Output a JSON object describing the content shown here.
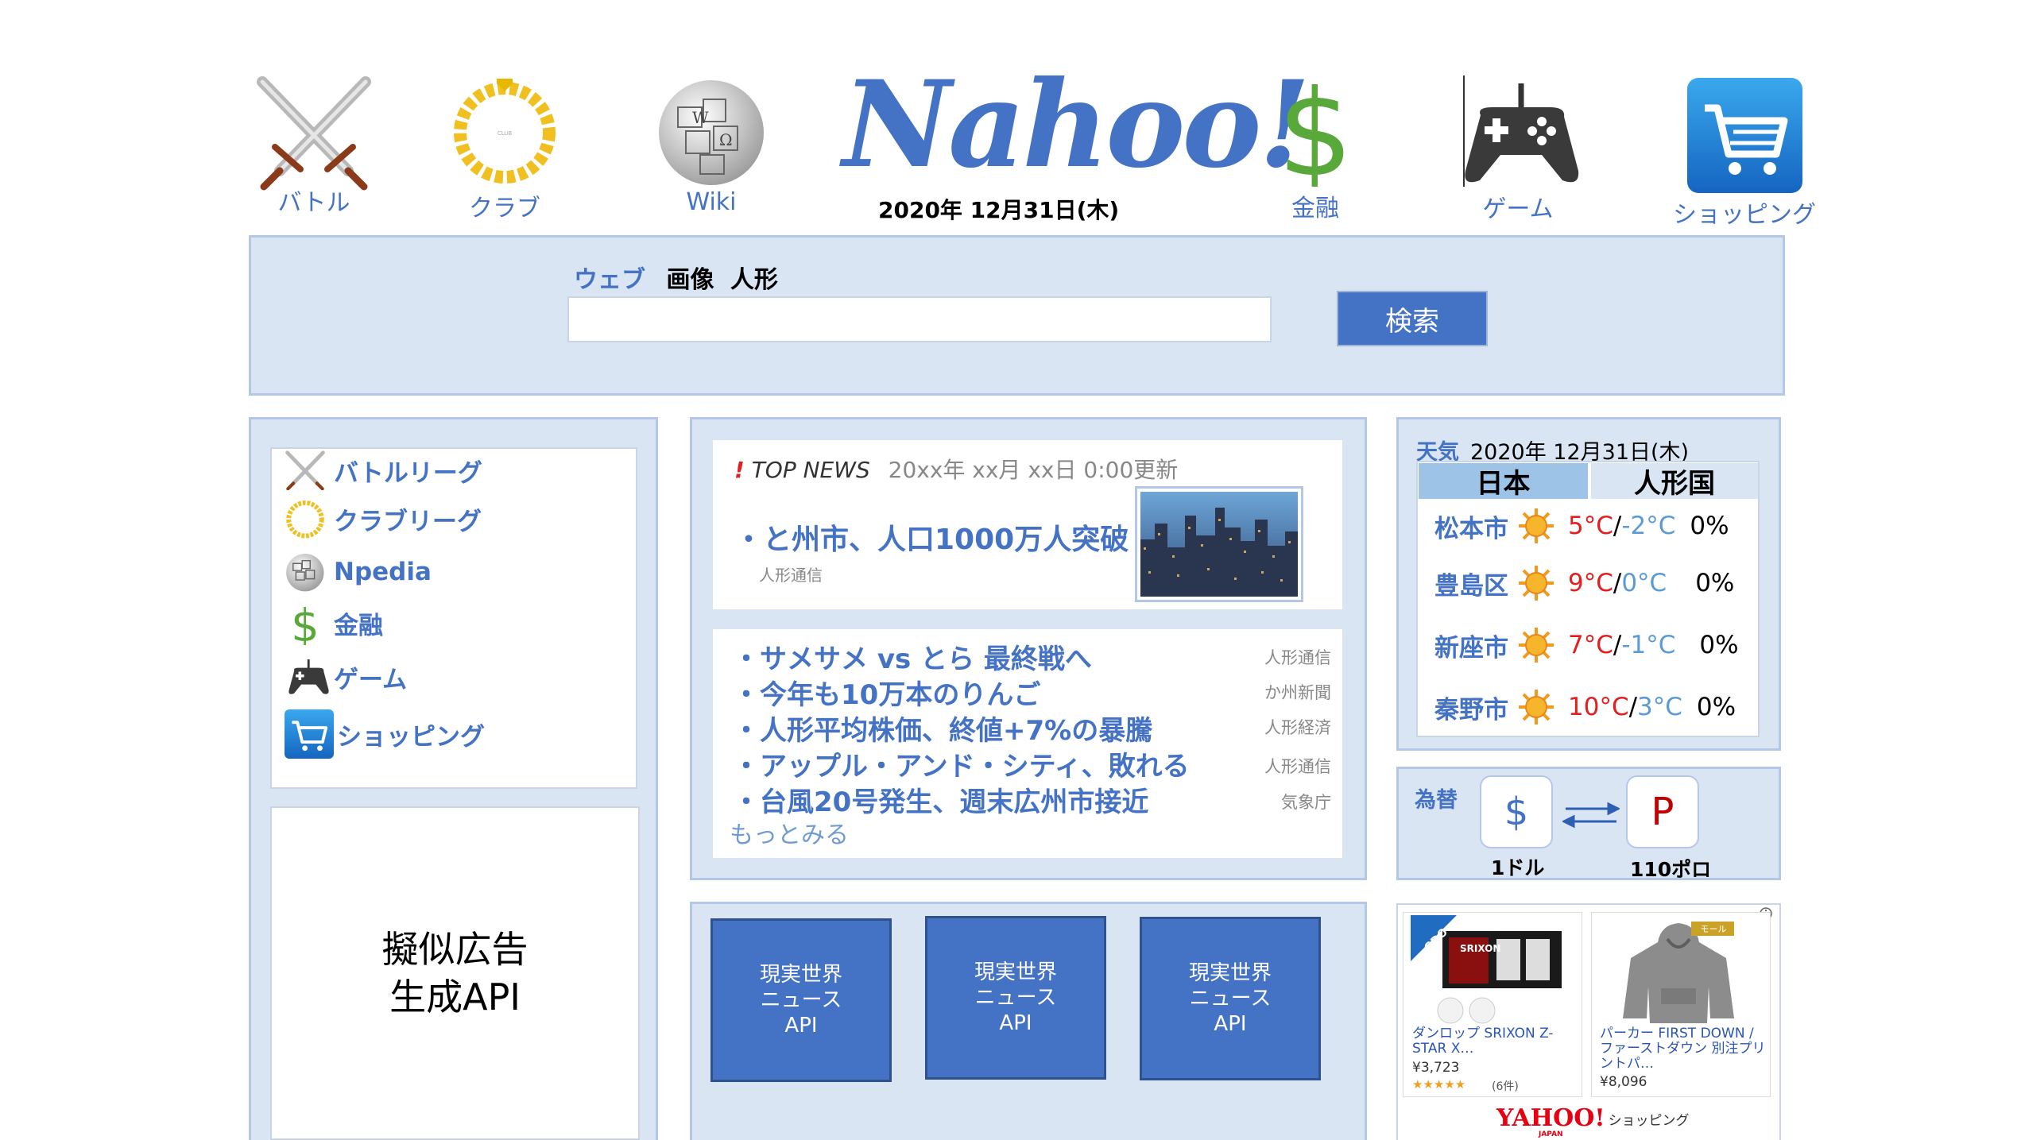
{
  "nav": {
    "battle": "バトル",
    "club": "クラブ",
    "wiki": "Wiki",
    "finance": "金融",
    "game": "ゲーム",
    "shopping": "ショッピング"
  },
  "logo": "Nahoo!",
  "date_top": "2020年 12月31日(木)",
  "search": {
    "tabs": {
      "web": "ウェブ",
      "image": "画像",
      "doll": "人形"
    },
    "button": "検索",
    "value": ""
  },
  "left_menu": {
    "items": [
      "バトルリーグ",
      "クラブリーグ",
      "Npedia",
      "金融",
      "ゲーム",
      "ショッピング"
    ]
  },
  "ad": {
    "line1": "擬似広告",
    "line2": "生成API"
  },
  "top_news": {
    "mark": "!",
    "label": "TOP NEWS",
    "updated": "20xx年 xx月 xx日 0:00更新",
    "headline": "・と州市、人口1000万人突破",
    "headline_source": "人形通信"
  },
  "news": {
    "items": [
      {
        "title": "・サメサメ vs とら 最終戦へ",
        "source": "人形通信"
      },
      {
        "title": "・今年も10万本のりんご",
        "source": "か州新聞"
      },
      {
        "title": "・人形平均株価、終値+7%の暴騰",
        "source": "人形経済"
      },
      {
        "title": "・アップル・アンド・シティ、敗れる",
        "source": "人形通信"
      },
      {
        "title": "・台風20号発生、週末広州市接近",
        "source": "気象庁"
      }
    ],
    "more": "もっとみる"
  },
  "api_boxes": [
    {
      "l1": "現実世界",
      "l2": "ニュース",
      "l3": "API"
    },
    {
      "l1": "現実世界",
      "l2": "ニュース",
      "l3": "API"
    },
    {
      "l1": "現実世界",
      "l2": "ニュース",
      "l3": "API"
    }
  ],
  "weather": {
    "label": "天気",
    "date": "2020年 12月31日(木)",
    "tabs": [
      "日本",
      "人形国"
    ],
    "rows": [
      {
        "city": "松本市",
        "hi": "5°C",
        "lo": "-2°C",
        "pct": "0%"
      },
      {
        "city": "豊島区",
        "hi": "9°C",
        "lo": "0°C",
        "pct": "0%"
      },
      {
        "city": "新座市",
        "hi": "7°C",
        "lo": "-1°C",
        "pct": "0%"
      },
      {
        "city": "秦野市",
        "hi": "10°C",
        "lo": "3°C",
        "pct": "0%"
      }
    ],
    "slash": "/"
  },
  "fx": {
    "label": "為替",
    "left_symbol": "$",
    "right_symbol": "P",
    "left_label": "1ドル",
    "right_label": "110ポロ"
  },
  "shop_ad": {
    "item1": {
      "badge": "GDO",
      "brand": "SRIXON",
      "title": "ダンロップ SRIXON Z-STAR X…",
      "price": "¥3,723",
      "stars": "★★★★★",
      "reviews": "(6件)"
    },
    "item2": {
      "badge": "モール",
      "title": "パーカー FIRST DOWN /ファーストダウン 別注プリントパ…",
      "price": "¥8,096"
    },
    "footer_logo": "YAHOO!",
    "footer_sub": "JAPAN",
    "footer_label": "ショッピング"
  },
  "colors": {
    "accent": "#4472c4",
    "panel": "#dae5f4",
    "border": "#b4c7e7",
    "hot": "#e41e1e",
    "cold": "#5b9bd5"
  }
}
